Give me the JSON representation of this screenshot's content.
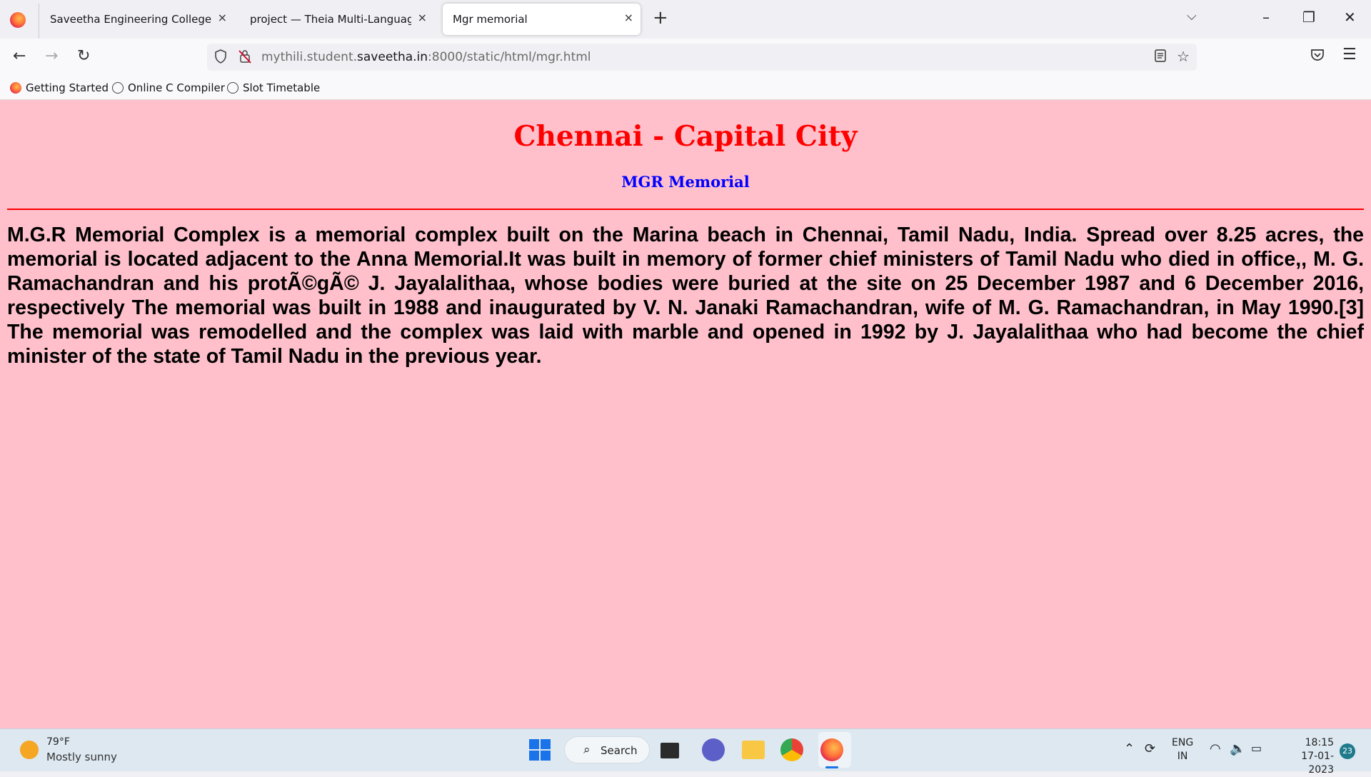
{
  "browser": {
    "tabs": [
      {
        "label": "Saveetha Engineering College",
        "close": "×"
      },
      {
        "label": "project — Theia Multi-Language Ex",
        "close": "×"
      },
      {
        "label": "Mgr memorial",
        "close": "×"
      }
    ],
    "new_tab": "+",
    "tab_list": "⌵",
    "window": {
      "minimize": "–",
      "maximize": "❐",
      "close": "✕"
    },
    "nav": {
      "back": "←",
      "forward": "→",
      "reload": "↻"
    },
    "url": {
      "prefix": "mythili.student.",
      "domain": "saveetha.in",
      "suffix": ":8000/static/html/mgr.html"
    },
    "bookmarks": [
      "Getting Started",
      "Online C Compiler",
      "Slot Timetable"
    ]
  },
  "page": {
    "title": "Chennai - Capital City",
    "subtitle": "MGR Memorial",
    "paragraph": "M.G.R Memorial Complex is a memorial complex built on the Marina beach in Chennai, Tamil Nadu, India. Spread over 8.25 acres, the memorial is located adjacent to the Anna Memorial.It was built in memory of former chief ministers of Tamil Nadu who died in office,, M. G. Ramachandran and his protÃ©gÃ© J. Jayalalithaa, whose bodies were buried at the site on 25 December 1987 and 6 December 2016, respectively The memorial was built in 1988 and inaugurated by V. N. Janaki Ramachandran, wife of M. G. Ramachandran, in May 1990.[3] The memorial was remodelled and the complex was laid with marble and opened in 1992 by J. Jayalalithaa who had become the chief minister of the state of Tamil Nadu in the previous year.",
    "colors": {
      "background": "#ffc0cb",
      "title": "#ff0000",
      "subtitle": "#0000ff",
      "rule": "#ff0000"
    }
  },
  "taskbar": {
    "weather": {
      "temp": "79°F",
      "desc": "Mostly sunny"
    },
    "search_label": "Search",
    "lang": {
      "line1": "ENG",
      "line2": "IN"
    },
    "clock": {
      "time": "18:15",
      "date": "17-01-2023"
    },
    "notifications": "23"
  }
}
